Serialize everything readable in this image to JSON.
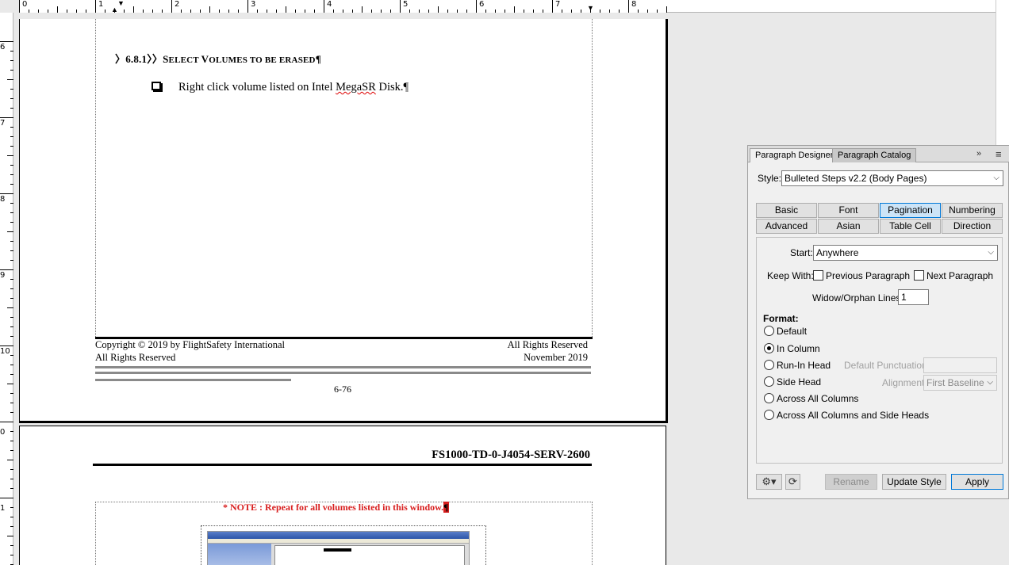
{
  "ruler": {
    "h_numbers": [
      "0",
      "1",
      "2",
      "3",
      "4",
      "5",
      "6",
      "7",
      "8"
    ],
    "v_numbers": [
      "6",
      "7",
      "8",
      "9",
      "10",
      "0",
      "1"
    ]
  },
  "page1": {
    "heading_prefix": "〉6.8.1〉〉",
    "heading_s": "S",
    "heading_elect": "ELECT ",
    "heading_v": "V",
    "heading_olumes": "OLUMES TO BE ERASED",
    "heading_mark": "¶",
    "bullet_before": "Right click volume listed on Intel ",
    "bullet_word": "MegaSR",
    "bullet_after": " Disk.",
    "bullet_mark": "¶",
    "footer_left_1": "Copyright © 2019 by FlightSafety International",
    "footer_left_2": "All Rights Reserved",
    "footer_right_1": "All Rights Reserved",
    "footer_right_2": "November 2019",
    "page_number": "6-76"
  },
  "page2": {
    "doc_id": "FS1000-TD-0-J4054-SERV-2600",
    "note_label": "* NOTE : ",
    "note_text": "Repeat for all volumes listed in this window.",
    "note_mark": "¶"
  },
  "panel": {
    "tab_designer": "Paragraph Designer",
    "tab_catalog": "Paragraph Catalog",
    "more_glyph": "»",
    "menu_glyph": "≡",
    "style_label": "Style:",
    "style_value": "Bulleted Steps v2.2 (Body Pages)",
    "tabs": [
      "Basic",
      "Font",
      "Pagination",
      "Numbering",
      "Advanced",
      "Asian",
      "Table Cell",
      "Direction"
    ],
    "selected_tab": "Pagination",
    "start_label": "Start:",
    "start_value": "Anywhere",
    "keep_with_label": "Keep With:",
    "prev_para": "Previous Paragraph",
    "next_para": "Next Paragraph",
    "widow_label": "Widow/Orphan Lines:",
    "widow_value": "1",
    "format_label": "Format:",
    "formats": [
      "Default",
      "In Column",
      "Run-In Head",
      "Side Head",
      "Across All Columns",
      "Across All Columns and Side Heads"
    ],
    "selected_format": "In Column",
    "default_punct_label": "Default Punctuation:",
    "default_punct_value": "",
    "alignment_label": "Alignment:",
    "alignment_value": "First Baseline",
    "gear_glyph": "⚙▾",
    "refresh_glyph": "⟳",
    "rename": "Rename",
    "update_style": "Update Style",
    "apply": "Apply"
  }
}
